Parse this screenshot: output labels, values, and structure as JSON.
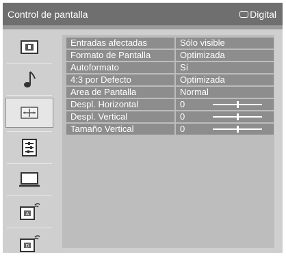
{
  "header": {
    "title": "Control de pantalla",
    "digital_label": "Digital"
  },
  "sidebar": {
    "items": [
      {
        "icon": "picture-icon"
      },
      {
        "icon": "music-note-icon"
      },
      {
        "icon": "screen-control-icon",
        "selected": true
      },
      {
        "icon": "settings-list-icon"
      },
      {
        "icon": "monitor-icon"
      },
      {
        "icon": "analog-setup-icon"
      },
      {
        "icon": "digital-setup-icon"
      }
    ]
  },
  "settings": {
    "rows": [
      {
        "label": "Entradas afectadas",
        "value": "Sólo visible"
      },
      {
        "label": "Formato de Pantalla",
        "value": "Optimizada"
      },
      {
        "label": "Autoformato",
        "value": "Sí"
      },
      {
        "label": "4:3 por Defecto",
        "value": "Optimizada"
      },
      {
        "label": "Area de Pantalla",
        "value": "Normal"
      },
      {
        "label": "Despl. Horizontal",
        "value": "0",
        "slider_level": 0.5
      },
      {
        "label": "Despl. Vertical",
        "value": "0",
        "slider_level": 0.5
      },
      {
        "label": "Tamaño Vertical",
        "value": "0",
        "slider_level": 0.5
      }
    ]
  }
}
